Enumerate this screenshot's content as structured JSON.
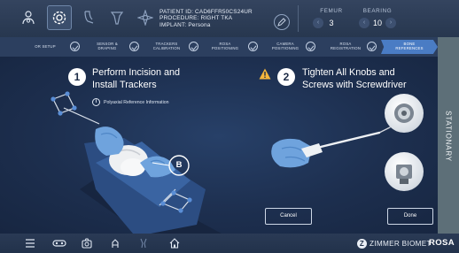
{
  "topbar": {
    "icons": [
      "user-gear-icon",
      "target-settings-icon",
      "foot-icon",
      "tibia-icon",
      "compass-icon"
    ],
    "active_icon": "target-settings-icon",
    "patient_id": "PATIENT ID: CAD6FFR50CS24UR",
    "procedure": "PROCEDURE: RIGHT TKA",
    "implant": "IMPLANT: Persona",
    "edit_icon": "pencil-icon",
    "femur": {
      "label": "FEMUR",
      "value": "3"
    },
    "bearing": {
      "label": "BEARING",
      "value": "10"
    }
  },
  "steps": [
    {
      "label": "OR SETUP",
      "done": true
    },
    {
      "label": "SENSOR &\nDRAPING",
      "done": true
    },
    {
      "label": "TRACKERS\nCALIBRATION",
      "done": true
    },
    {
      "label": "ROSA\nPOSITIONING",
      "done": true
    },
    {
      "label": "CAMERA\nPOSITIONING",
      "done": true
    },
    {
      "label": "ROSA\nREGISTRATION",
      "done": true
    },
    {
      "label": "BONE\nREFERENCES",
      "current": true
    }
  ],
  "stationary_label": "STATIONARY",
  "instruction1": {
    "number": "1",
    "line1": "Perform Incision and",
    "line2": "Install Trackers",
    "info": "Polyaxial Reference Information",
    "callout": "B"
  },
  "instruction2": {
    "number": "2",
    "line1": "Tighten All Knobs and",
    "line2": "Screws with Screwdriver",
    "warning_icon": "warning-icon"
  },
  "buttons": {
    "cancel": "Cancel",
    "done": "Done"
  },
  "bottombar": {
    "icons": [
      "menu-icon",
      "tracker-icon",
      "camera-icon",
      "robot-arm-icon",
      "knee-icon",
      "home-icon"
    ],
    "brand": "ZIMMER BIOMET",
    "product": "ROSA"
  },
  "colors": {
    "background": "#1b2a45",
    "active_step": "#4a7cc4",
    "warning": "#f5b63c",
    "stationary_panel": "#5d6f78"
  }
}
